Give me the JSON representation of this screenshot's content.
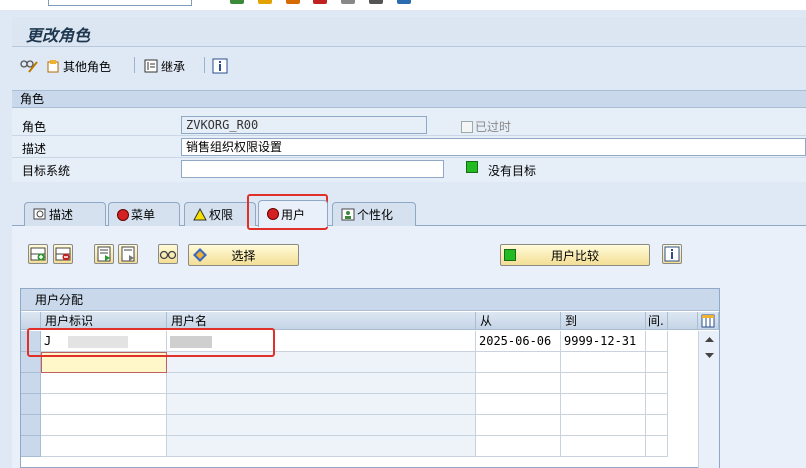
{
  "title": "更改角色",
  "toolbar": {
    "other_role_label": "其他角色",
    "inherit_label": "继承"
  },
  "role_panel": {
    "header": "角色",
    "role_label": "角色",
    "role_value": "ZVKORG_R00",
    "obsolete_label": "已过时",
    "desc_label": "描述",
    "desc_value": "销售组织权限设置",
    "target_label": "目标系统",
    "target_value": "",
    "no_target_label": "没有目标"
  },
  "tabs": [
    {
      "label": "描述"
    },
    {
      "label": "菜单"
    },
    {
      "label": "权限"
    },
    {
      "label": "用户"
    },
    {
      "label": "个性化"
    }
  ],
  "user_tab": {
    "select_label": "选择",
    "user_compare_label": "用户比较",
    "grid_title": "用户分配",
    "columns": [
      "用户标识",
      "用户名",
      "从",
      "到",
      "间."
    ],
    "rows": [
      {
        "user_id": "J",
        "user_name": "",
        "from": "2025-06-06",
        "to": "9999-12-31"
      }
    ]
  },
  "colors": {
    "accent_red": "#e0302a",
    "status_green": "#22bb22",
    "button_yellow": "#f3de95"
  }
}
